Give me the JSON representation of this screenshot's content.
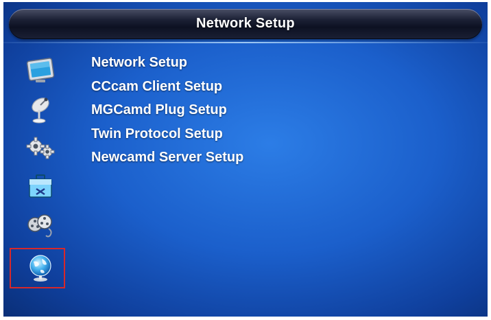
{
  "header": {
    "title": "Network Setup"
  },
  "menu": {
    "items": [
      {
        "label": "Network Setup"
      },
      {
        "label": "CCcam Client Setup"
      },
      {
        "label": "MGCamd Plug Setup"
      },
      {
        "label": "Twin Protocol Setup"
      },
      {
        "label": "Newcamd Server Setup"
      }
    ]
  },
  "sidebar": {
    "icons": [
      {
        "name": "tv-icon"
      },
      {
        "name": "satellite-dish-icon"
      },
      {
        "name": "gears-icon"
      },
      {
        "name": "toolbox-icon"
      },
      {
        "name": "film-reel-icon"
      },
      {
        "name": "globe-icon",
        "selected": true
      }
    ]
  },
  "colors": {
    "background": "#1b5fcb",
    "title_bar": "#0d1122",
    "selection_border": "#d8282a",
    "text": "#ffffff"
  }
}
